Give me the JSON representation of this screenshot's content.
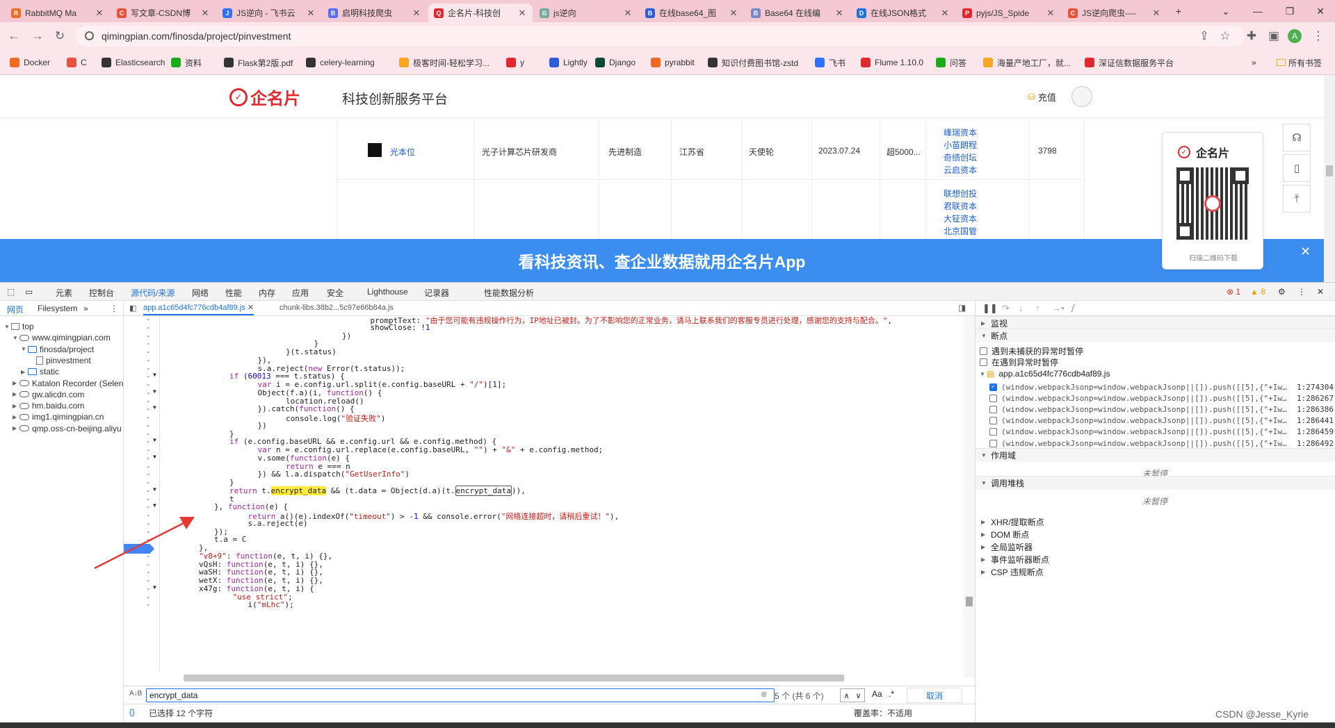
{
  "tabs": [
    {
      "title": "RabbitMQ Ma",
      "color": "#f06a21",
      "glyph": "R"
    },
    {
      "title": "写文章-CSDN博",
      "color": "#e8533d",
      "glyph": "C"
    },
    {
      "title": "JS逆向 - 飞书云",
      "color": "#3370ff",
      "glyph": "J"
    },
    {
      "title": "启明科技爬虫",
      "color": "#5b6ef3",
      "glyph": "B"
    },
    {
      "title": "企名片-科技创",
      "color": "#e0282e",
      "glyph": "Q"
    },
    {
      "title": "js逆向",
      "color": "#74aa9c",
      "glyph": "G"
    },
    {
      "title": "在线base64_图",
      "color": "#2e5cd6",
      "glyph": "B"
    },
    {
      "title": "Base64 在线编",
      "color": "#7b88c8",
      "glyph": "B"
    },
    {
      "title": "在线JSON格式",
      "color": "#1f74d6",
      "glyph": "D"
    },
    {
      "title": "pyjs/JS_Spide",
      "color": "#e0282e",
      "glyph": "P"
    },
    {
      "title": "JS逆向爬虫----",
      "color": "#e8533d",
      "glyph": "C"
    }
  ],
  "address": {
    "url": "qimingpian.com/finosda/project/pinvestment"
  },
  "bookmarks": [
    {
      "label": "Docker",
      "color": "#f06a21"
    },
    {
      "label": "C",
      "color": "#e8533d"
    },
    {
      "label": "Elasticsearch",
      "color": "#333333"
    },
    {
      "label": "资料",
      "color": "#1aad19"
    },
    {
      "label": "Flask第2版.pdf",
      "color": "#333333"
    },
    {
      "label": "celery-learning",
      "color": "#333333"
    },
    {
      "label": "极客时间-轻松学习...",
      "color": "#f5a623"
    },
    {
      "label": "y",
      "color": "#e0282e"
    },
    {
      "label": "Lightly",
      "color": "#2e5cd6"
    },
    {
      "label": "Django",
      "color": "#0c4b33"
    },
    {
      "label": "pyrabbit",
      "color": "#f06a21"
    },
    {
      "label": "知识付费图书馆-zstd",
      "color": "#333333"
    },
    {
      "label": "飞书",
      "color": "#3370ff"
    },
    {
      "label": "Flume 1.10.0",
      "color": "#e0282e"
    },
    {
      "label": "问答",
      "color": "#1aad19"
    },
    {
      "label": "海量产地工厂，就...",
      "color": "#f5a623"
    },
    {
      "label": "深证信数据服务平台",
      "color": "#e0282e"
    }
  ],
  "bookmarks_all": "所有书签",
  "site": {
    "logo": "企名片",
    "tagline": "科技创新服务平台",
    "recharge": "充值",
    "row": {
      "name": "光本位",
      "desc": "光子计算芯片研发商",
      "industry": "先进制造",
      "province": "江苏省",
      "round": "天使轮",
      "date": "2023.07.24",
      "amount": "超5000...",
      "investors": [
        "峰瑞资本",
        "小苗朗程",
        "奇绩创坛",
        "云启资本"
      ],
      "count": "3798"
    },
    "row2_investors": [
      "联想创投",
      "君联资本",
      "大钲资本",
      "北京国管"
    ],
    "panel_title": "企名片",
    "panel_hint": "扫描二维码下载",
    "banner": "看科技资讯、查企业数据就用企名片App"
  },
  "devtools": {
    "tabs": [
      "元素",
      "控制台",
      "源代码/来源",
      "网络",
      "性能",
      "内存",
      "应用",
      "安全",
      "Lighthouse",
      "记录器",
      "性能数据分析"
    ],
    "errors": "1",
    "warnings": "8",
    "nav_tabs": [
      "网页",
      "Filesystem"
    ],
    "tree": [
      {
        "label": "top",
        "type": "top",
        "indent": 0
      },
      {
        "label": "www.qimingpian.com",
        "type": "cloud",
        "indent": 1
      },
      {
        "label": "finosda/project",
        "type": "folder",
        "indent": 2
      },
      {
        "label": "pinvestment",
        "type": "file",
        "indent": 3
      },
      {
        "label": "static",
        "type": "folder",
        "indent": 2
      },
      {
        "label": "Katalon Recorder (Selen",
        "type": "cloud",
        "indent": 1
      },
      {
        "label": "gw.alicdn.com",
        "type": "cloud",
        "indent": 1
      },
      {
        "label": "hm.baidu.com",
        "type": "cloud",
        "indent": 1
      },
      {
        "label": "img1.qimingpian.cn",
        "type": "cloud",
        "indent": 1
      },
      {
        "label": "qmp.oss-cn-beijing.aliyu",
        "type": "cloud",
        "indent": 1
      }
    ],
    "file_tabs": [
      "app.a1c65d4fc776cdb4af89.js",
      "chunk-libs.38b2...5c97e66b84a.js"
    ],
    "code_lines": [
      "                    promptText: \"由于您可能有违规操作行为，IP地址已被封。为了不影响您的正常业务，请马上联系我们的客服专员进行处理，感谢您的支持与配合。\",",
      "                    showClose: !1",
      "                })",
      "            }",
      "        }(t.status)",
      "    }),",
      "    s.a.reject(new Error(t.status));",
      "if (60013 === t.status) {",
      "    var i = e.config.url.split(e.config.baseURL + \"/\")[1];",
      "    Object(f.a)(i, function() {",
      "        location.reload()",
      "    }).catch(function() {",
      "        console.log(\"验证失败\")",
      "    })",
      "}",
      "if (e.config.baseURL && e.config.url && e.config.method) {",
      "    var n = e.config.url.replace(e.config.baseURL, \"\") + \"&\" + e.config.method;",
      "    v.some(function(e) {",
      "        return e === n",
      "    }) && l.a.dispatch(\"GetUserInfo\")",
      "}",
      "return t.encrypt_data && (t.data = Object(d.a)(t.encrypt_data)),",
      "t",
      "}, function(e) {",
      "    return a()(e).indexOf(\"timeout\") > -1 && console.error(\"网络连接超时，请稍后重试！\"),",
      "    s.a.reject(e)",
      "});",
      "t.a = C",
      "},",
      "\"v8+9\": function(e, t, i) {},",
      "vQsH: function(e, t, i) {},",
      "waSH: function(e, t, i) {},",
      "wetX: function(e, t, i) {},",
      "x47g: function(e, t, i) {",
      "    \"use strict\";",
      "    i(\"mLhc\");"
    ],
    "search": {
      "value": "encrypt_data",
      "result": "5 个 (共 6 个)",
      "match_case": "Aa",
      "regex": ".*",
      "cancel": "取消"
    },
    "status": {
      "selected": "已选择 12 个字符",
      "coverage": "覆盖率：不适用"
    },
    "debugger": {
      "watch": "监视",
      "breakpoints": "断点",
      "pause_uncaught": "遇到未捕获的异常时暂停",
      "pause_caught": "在遇到异常时暂停",
      "bp_file": "app.a1c65d4fc776cdb4af89.js",
      "bp_items": [
        {
          "code": "(window.webpackJsonp=window.webpackJsonp||[]).push([[5],{\"+Iw…",
          "line": "1:274304",
          "checked": true
        },
        {
          "code": "(window.webpackJsonp=window.webpackJsonp||[]).push([[5],{\"+Iw…",
          "line": "1:286267",
          "checked": false
        },
        {
          "code": "(window.webpackJsonp=window.webpackJsonp||[]).push([[5],{\"+Iw…",
          "line": "1:286386",
          "checked": false
        },
        {
          "code": "(window.webpackJsonp=window.webpackJsonp||[]).push([[5],{\"+Iw…",
          "line": "1:286441",
          "checked": false
        },
        {
          "code": "(window.webpackJsonp=window.webpackJsonp||[]).push([[5],{\"+Iw…",
          "line": "1:286459",
          "checked": false
        },
        {
          "code": "(window.webpackJsonp=window.webpackJsonp||[]).push([[5],{\"+Iw…",
          "line": "1:286492",
          "checked": false
        }
      ],
      "scope": "作用域",
      "not_paused": "未暂停",
      "callstack": "调用堆栈",
      "sections": [
        "XHR/提取断点",
        "DOM 断点",
        "全局监听器",
        "事件监听器断点",
        "CSP 违规断点"
      ]
    }
  },
  "watermark": "CSDN @Jesse_Kyrie"
}
